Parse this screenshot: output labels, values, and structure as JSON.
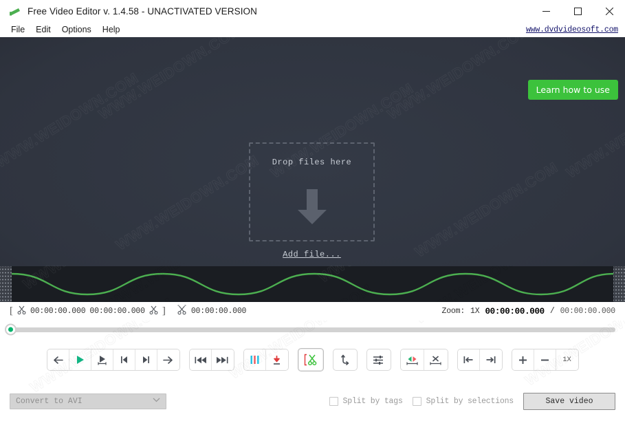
{
  "window": {
    "title": "Free Video Editor v. 1.4.58 - UNACTIVATED VERSION",
    "app_icon": "video-editor-icon",
    "minimize_label": "–",
    "maximize_label": "□",
    "close_label": "×"
  },
  "menubar": {
    "items": [
      {
        "label": "File"
      },
      {
        "label": "Edit"
      },
      {
        "label": "Options"
      },
      {
        "label": "Help"
      }
    ],
    "site_link": "www.dvdvideosoft.com"
  },
  "video_area": {
    "learn_button": "Learn how to use",
    "drop_text": "Drop files here",
    "add_file_link": "Add file...",
    "arrow_icon": "down-arrow-icon"
  },
  "waveform": {
    "left_handle": "waveform-left-handle",
    "right_handle": "waveform-right-handle",
    "color": "#4caf50"
  },
  "timecode": {
    "selection_start": "00:00:00.000",
    "selection_end": "00:00:00.000",
    "marker_time": "00:00:00.000",
    "zoom_label": "Zoom:",
    "zoom_value": "1X",
    "current_time": "00:00:00.000",
    "separator": "/",
    "total_time": "00:00:00.000"
  },
  "seek": {
    "position_percent": 0
  },
  "toolbar": {
    "groups": [
      {
        "name": "playback-group",
        "buttons": [
          {
            "name": "step-back-button",
            "icon": "arrow-left-icon"
          },
          {
            "name": "play-button",
            "icon": "play-icon"
          },
          {
            "name": "play-selection-button",
            "icon": "play-selection-icon"
          },
          {
            "name": "previous-marker-button",
            "icon": "skip-start-icon"
          },
          {
            "name": "next-marker-button",
            "icon": "skip-end-icon"
          },
          {
            "name": "step-forward-button",
            "icon": "arrow-right-icon"
          }
        ]
      },
      {
        "name": "jump-group",
        "buttons": [
          {
            "name": "jump-to-start-button",
            "icon": "rewind-icon"
          },
          {
            "name": "jump-to-end-button",
            "icon": "fast-forward-icon"
          }
        ]
      },
      {
        "name": "marker-group",
        "buttons": [
          {
            "name": "add-tag-button",
            "icon": "three-bars-icon"
          },
          {
            "name": "insert-tag-button",
            "icon": "down-arrow-line-icon"
          }
        ]
      }
    ],
    "cut_button": {
      "name": "cut-selection-button",
      "icon": "scissors-bracket-icon"
    },
    "after_cut_buttons": [
      {
        "name": "invert-selection-button",
        "icon": "rotate-arrow-icon"
      },
      {
        "name": "preferences-button",
        "icon": "sliders-icon"
      }
    ],
    "edit_group": [
      {
        "name": "merge-segments-button",
        "icon": "merge-arrows-icon"
      },
      {
        "name": "delete-segment-button",
        "icon": "delete-segment-icon"
      }
    ],
    "nav_group": [
      {
        "name": "selection-start-button",
        "icon": "to-start-icon"
      },
      {
        "name": "selection-end-button",
        "icon": "to-end-icon"
      }
    ],
    "zoom_group": [
      {
        "name": "zoom-in-button",
        "icon": "plus-icon",
        "label": "+"
      },
      {
        "name": "zoom-out-button",
        "icon": "minus-icon",
        "label": "−"
      },
      {
        "name": "zoom-reset-button",
        "icon": "zoom-reset-icon",
        "label": "1X"
      }
    ]
  },
  "bottom": {
    "format_value": "Convert to AVI",
    "format_caret": "⌄",
    "split_by_tags_label": "Split by tags",
    "split_by_tags_checked": false,
    "split_by_selections_label": "Split by selections",
    "split_by_selections_checked": false,
    "save_button": "Save video"
  },
  "watermark": {
    "text": "WWW.WEIDOWN.COM"
  }
}
